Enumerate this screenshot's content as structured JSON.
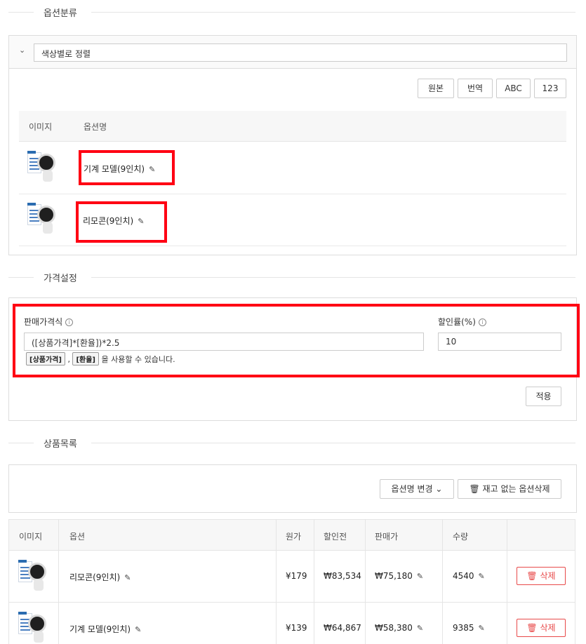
{
  "sections": {
    "options_title": "옵션분류",
    "price_title": "가격설정",
    "products_title": "상품목록"
  },
  "option_group": {
    "sort_value": "색상별로 정렬",
    "buttons": [
      "원본",
      "번역",
      "ABC",
      "123"
    ],
    "col_image": "이미지",
    "col_name": "옵션명",
    "rows": [
      {
        "name": "기계 모델(9인치)"
      },
      {
        "name": "리모콘(9인치)"
      }
    ]
  },
  "price": {
    "formula_label": "판매가격식",
    "formula_value": "([상품가격]*[환율])*2.5",
    "chip_price": "[상품가격]",
    "chip_sep": ",",
    "chip_rate": "[환율]",
    "hint_text": "을 사용할 수 있습니다.",
    "discount_label": "할인률(%)",
    "discount_value": "10",
    "apply_label": "적용"
  },
  "product_list": {
    "rename_label": "옵션명 변경",
    "delete_oos_label": "재고 없는 옵션삭제",
    "columns": [
      "이미지",
      "옵션",
      "원가",
      "할인전",
      "판매가",
      "수량"
    ],
    "rows": [
      {
        "option": "리모콘(9인치)",
        "cost": "¥179",
        "before": "₩83,534",
        "price": "₩75,180",
        "qty": "4540",
        "delete": "삭제"
      },
      {
        "option": "기계 모델(9인치)",
        "cost": "¥139",
        "before": "₩64,867",
        "price": "₩58,380",
        "qty": "9385",
        "delete": "삭제"
      }
    ]
  },
  "colors": {
    "highlight": "#ff0013",
    "danger": "#e84a4a",
    "border": "#dddddd"
  }
}
